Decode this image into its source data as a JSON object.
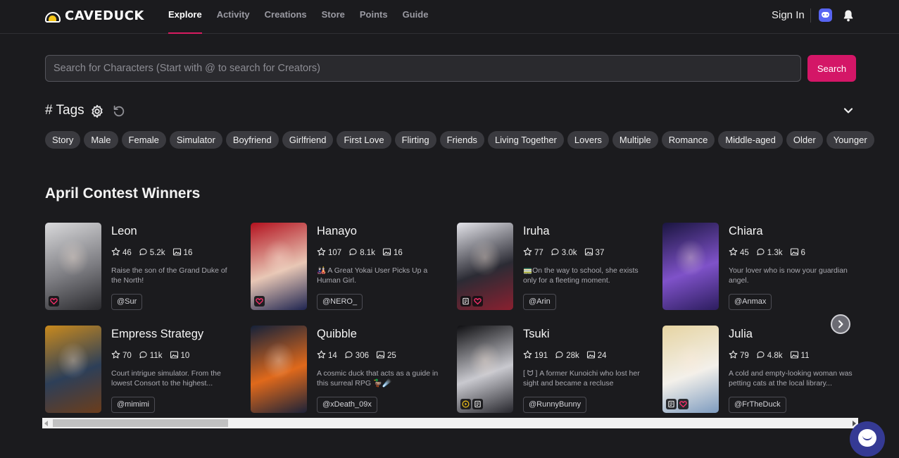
{
  "brand": {
    "name": "CAVEDUCK"
  },
  "nav": {
    "items": [
      {
        "label": "Explore",
        "active": true
      },
      {
        "label": "Activity"
      },
      {
        "label": "Creations"
      },
      {
        "label": "Store"
      },
      {
        "label": "Points"
      },
      {
        "label": "Guide"
      }
    ]
  },
  "header": {
    "signin_label": "Sign In"
  },
  "search": {
    "placeholder": "Search for Characters (Start with @ to search for Creators)",
    "value": "",
    "button_label": "Search"
  },
  "tags": {
    "title": "# Tags",
    "items": [
      "Story",
      "Male",
      "Female",
      "Simulator",
      "Boyfriend",
      "Girlfriend",
      "First Love",
      "Flirting",
      "Friends",
      "Living Together",
      "Lovers",
      "Multiple",
      "Romance",
      "Middle-aged",
      "Older",
      "Younger"
    ]
  },
  "section": {
    "title": "April Contest Winners"
  },
  "characters": [
    {
      "name": "Leon",
      "stars": "46",
      "chats": "5.2k",
      "images": "16",
      "description": "Raise the son of the Grand Duke of the North!",
      "creator": "@Sur",
      "badges": [
        "heart"
      ],
      "palette": [
        "#d9d9db",
        "#7d7d82",
        "#2a2a2e"
      ]
    },
    {
      "name": "Hanayo",
      "stars": "107",
      "chats": "8.1k",
      "images": "16",
      "description": "🎎 A Great Yokai User Picks Up a Human Girl.",
      "creator": "@NERO_",
      "badges": [
        "heart"
      ],
      "palette": [
        "#b3121f",
        "#e8c7b5",
        "#1e2450"
      ]
    },
    {
      "name": "Iruha",
      "stars": "77",
      "chats": "3.0k",
      "images": "37",
      "description": "🚃On the way to school, she exists only for a fleeting moment.",
      "creator": "@Arin",
      "badges": [
        "doc",
        "heart"
      ],
      "palette": [
        "#e4e4ea",
        "#2b2b34",
        "#8a2030"
      ]
    },
    {
      "name": "Chiara",
      "stars": "45",
      "chats": "1.3k",
      "images": "6",
      "description": "Your lover who is now your guardian angel.",
      "creator": "@Anmax",
      "badges": [],
      "palette": [
        "#1a1540",
        "#7f52c9",
        "#2c1d5e"
      ]
    },
    {
      "name": "Empress Strategy",
      "stars": "70",
      "chats": "11k",
      "images": "10",
      "description": "Court intrigue simulator. From the lowest Consort to the highest...",
      "creator": "@mimimi",
      "badges": [],
      "palette": [
        "#c98a1d",
        "#2d3f58",
        "#6c3d1b"
      ]
    },
    {
      "name": "Quibble",
      "stars": "14",
      "chats": "306",
      "images": "25",
      "description": "A cosmic duck that acts as a guide in this surreal RPG 🦆☄️",
      "creator": "@xDeath_09x",
      "badges": [],
      "palette": [
        "#14213a",
        "#e0691b",
        "#1c2238"
      ]
    },
    {
      "name": "Tsuki",
      "stars": "191",
      "chats": "28k",
      "images": "24",
      "description": "[ ᗢ ] A former Kunoichi who lost her sight and became a recluse",
      "creator": "@RunnyBunny",
      "badges": [
        "play",
        "doc"
      ],
      "palette": [
        "#0f0f12",
        "#c9c9cf",
        "#26262c"
      ]
    },
    {
      "name": "Julia",
      "stars": "79",
      "chats": "4.8k",
      "images": "11",
      "description": "A cold and empty-looking woman was petting cats at the local library...",
      "creator": "@FrTheDuck",
      "badges": [
        "doc",
        "heart"
      ],
      "palette": [
        "#e6d4a2",
        "#f3f0ea",
        "#7d9bbf"
      ]
    }
  ],
  "colors": {
    "accent": "#d41667",
    "background": "#1b1b1e",
    "chip": "#3a3a3f"
  }
}
